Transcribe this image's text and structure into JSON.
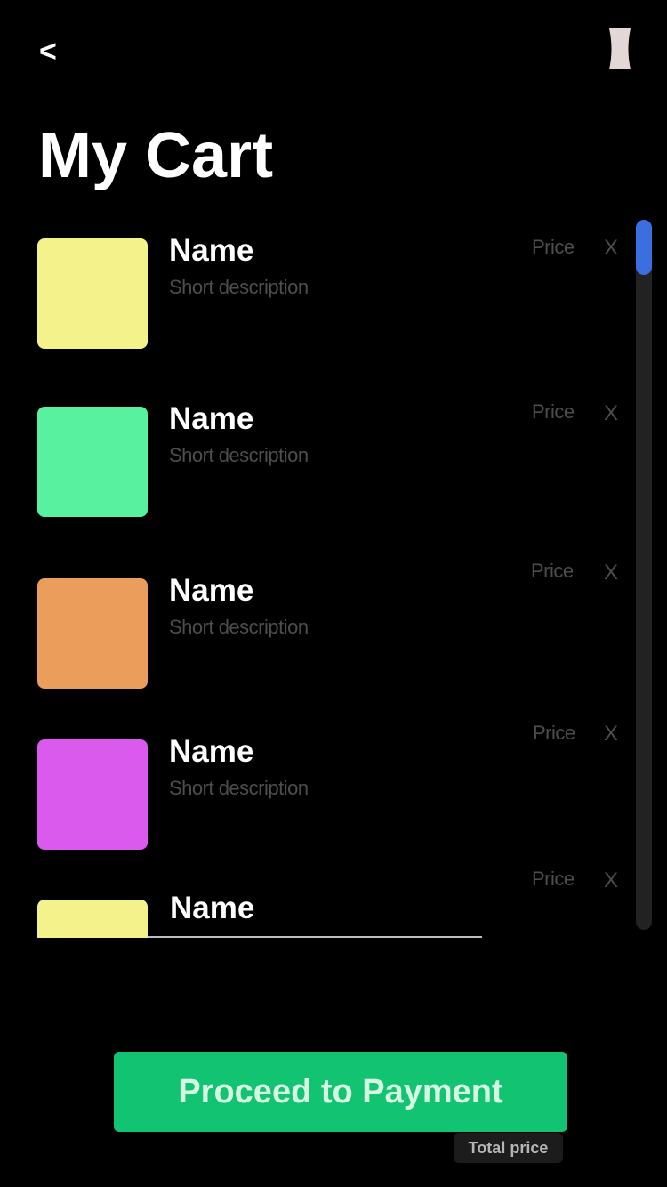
{
  "header": {
    "back_label": "<",
    "cart_icon": "shopping-bag-icon"
  },
  "page": {
    "title": "My Cart"
  },
  "cart": {
    "items": [
      {
        "name": "Name",
        "description": "Short description",
        "price": "Price",
        "remove": "X",
        "color": "#f4f28a"
      },
      {
        "name": "Name",
        "description": "Short description",
        "price": "Price",
        "remove": "X",
        "color": "#57f1a0"
      },
      {
        "name": "Name",
        "description": "Short description",
        "price": "Price",
        "remove": "X",
        "color": "#eb9e5b"
      },
      {
        "name": "Name",
        "description": "Short description",
        "price": "Price",
        "remove": "X",
        "color": "#d95aed"
      },
      {
        "name": "Name",
        "description": "",
        "price": "Price",
        "remove": "X",
        "color": "#f4f28a"
      }
    ]
  },
  "footer": {
    "proceed_label": "Proceed to Payment",
    "total_label": "Total price"
  },
  "colors": {
    "background": "#000000",
    "accent_green": "#12c471",
    "scroll_thumb": "#3b6fe0",
    "muted_text": "#4d4d4d",
    "icon_fill": "#e2d8d8"
  }
}
